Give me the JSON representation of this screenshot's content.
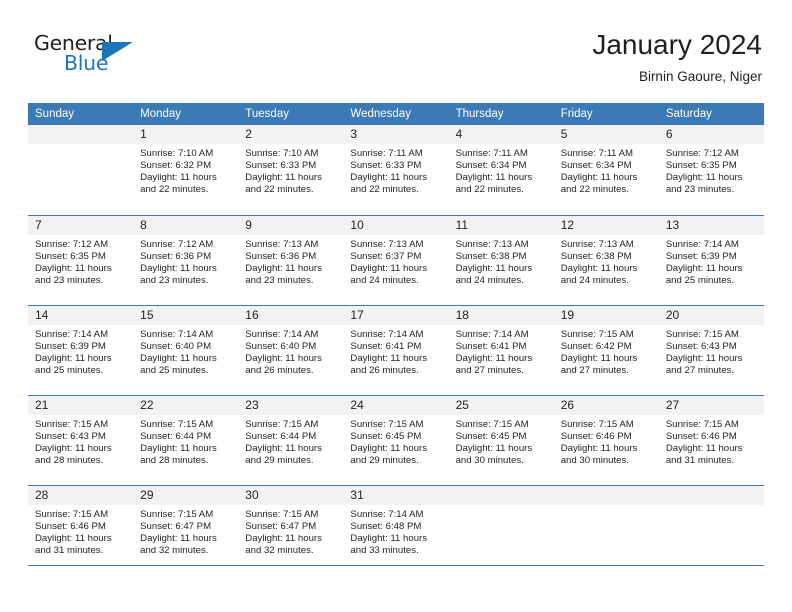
{
  "brand": {
    "name_top": "General",
    "name_bottom": "Blue",
    "accent_color": "#1b75bb"
  },
  "header": {
    "title": "January 2024",
    "subtitle": "Birnin Gaoure, Niger"
  },
  "theme": {
    "header_bg": "#3b7ab5",
    "daynum_bg": "#f2f2f2",
    "text": "#231f20"
  },
  "weekdays": [
    "Sunday",
    "Monday",
    "Tuesday",
    "Wednesday",
    "Thursday",
    "Friday",
    "Saturday"
  ],
  "weeks": [
    [
      {
        "day": "",
        "sunrise": "",
        "sunset": "",
        "daylight": "",
        "empty": true
      },
      {
        "day": "1",
        "sunrise": "Sunrise: 7:10 AM",
        "sunset": "Sunset: 6:32 PM",
        "daylight": "Daylight: 11 hours and 22 minutes."
      },
      {
        "day": "2",
        "sunrise": "Sunrise: 7:10 AM",
        "sunset": "Sunset: 6:33 PM",
        "daylight": "Daylight: 11 hours and 22 minutes."
      },
      {
        "day": "3",
        "sunrise": "Sunrise: 7:11 AM",
        "sunset": "Sunset: 6:33 PM",
        "daylight": "Daylight: 11 hours and 22 minutes."
      },
      {
        "day": "4",
        "sunrise": "Sunrise: 7:11 AM",
        "sunset": "Sunset: 6:34 PM",
        "daylight": "Daylight: 11 hours and 22 minutes."
      },
      {
        "day": "5",
        "sunrise": "Sunrise: 7:11 AM",
        "sunset": "Sunset: 6:34 PM",
        "daylight": "Daylight: 11 hours and 22 minutes."
      },
      {
        "day": "6",
        "sunrise": "Sunrise: 7:12 AM",
        "sunset": "Sunset: 6:35 PM",
        "daylight": "Daylight: 11 hours and 23 minutes."
      }
    ],
    [
      {
        "day": "7",
        "sunrise": "Sunrise: 7:12 AM",
        "sunset": "Sunset: 6:35 PM",
        "daylight": "Daylight: 11 hours and 23 minutes."
      },
      {
        "day": "8",
        "sunrise": "Sunrise: 7:12 AM",
        "sunset": "Sunset: 6:36 PM",
        "daylight": "Daylight: 11 hours and 23 minutes."
      },
      {
        "day": "9",
        "sunrise": "Sunrise: 7:13 AM",
        "sunset": "Sunset: 6:36 PM",
        "daylight": "Daylight: 11 hours and 23 minutes."
      },
      {
        "day": "10",
        "sunrise": "Sunrise: 7:13 AM",
        "sunset": "Sunset: 6:37 PM",
        "daylight": "Daylight: 11 hours and 24 minutes."
      },
      {
        "day": "11",
        "sunrise": "Sunrise: 7:13 AM",
        "sunset": "Sunset: 6:38 PM",
        "daylight": "Daylight: 11 hours and 24 minutes."
      },
      {
        "day": "12",
        "sunrise": "Sunrise: 7:13 AM",
        "sunset": "Sunset: 6:38 PM",
        "daylight": "Daylight: 11 hours and 24 minutes."
      },
      {
        "day": "13",
        "sunrise": "Sunrise: 7:14 AM",
        "sunset": "Sunset: 6:39 PM",
        "daylight": "Daylight: 11 hours and 25 minutes."
      }
    ],
    [
      {
        "day": "14",
        "sunrise": "Sunrise: 7:14 AM",
        "sunset": "Sunset: 6:39 PM",
        "daylight": "Daylight: 11 hours and 25 minutes."
      },
      {
        "day": "15",
        "sunrise": "Sunrise: 7:14 AM",
        "sunset": "Sunset: 6:40 PM",
        "daylight": "Daylight: 11 hours and 25 minutes."
      },
      {
        "day": "16",
        "sunrise": "Sunrise: 7:14 AM",
        "sunset": "Sunset: 6:40 PM",
        "daylight": "Daylight: 11 hours and 26 minutes."
      },
      {
        "day": "17",
        "sunrise": "Sunrise: 7:14 AM",
        "sunset": "Sunset: 6:41 PM",
        "daylight": "Daylight: 11 hours and 26 minutes."
      },
      {
        "day": "18",
        "sunrise": "Sunrise: 7:14 AM",
        "sunset": "Sunset: 6:41 PM",
        "daylight": "Daylight: 11 hours and 27 minutes."
      },
      {
        "day": "19",
        "sunrise": "Sunrise: 7:15 AM",
        "sunset": "Sunset: 6:42 PM",
        "daylight": "Daylight: 11 hours and 27 minutes."
      },
      {
        "day": "20",
        "sunrise": "Sunrise: 7:15 AM",
        "sunset": "Sunset: 6:43 PM",
        "daylight": "Daylight: 11 hours and 27 minutes."
      }
    ],
    [
      {
        "day": "21",
        "sunrise": "Sunrise: 7:15 AM",
        "sunset": "Sunset: 6:43 PM",
        "daylight": "Daylight: 11 hours and 28 minutes."
      },
      {
        "day": "22",
        "sunrise": "Sunrise: 7:15 AM",
        "sunset": "Sunset: 6:44 PM",
        "daylight": "Daylight: 11 hours and 28 minutes."
      },
      {
        "day": "23",
        "sunrise": "Sunrise: 7:15 AM",
        "sunset": "Sunset: 6:44 PM",
        "daylight": "Daylight: 11 hours and 29 minutes."
      },
      {
        "day": "24",
        "sunrise": "Sunrise: 7:15 AM",
        "sunset": "Sunset: 6:45 PM",
        "daylight": "Daylight: 11 hours and 29 minutes."
      },
      {
        "day": "25",
        "sunrise": "Sunrise: 7:15 AM",
        "sunset": "Sunset: 6:45 PM",
        "daylight": "Daylight: 11 hours and 30 minutes."
      },
      {
        "day": "26",
        "sunrise": "Sunrise: 7:15 AM",
        "sunset": "Sunset: 6:46 PM",
        "daylight": "Daylight: 11 hours and 30 minutes."
      },
      {
        "day": "27",
        "sunrise": "Sunrise: 7:15 AM",
        "sunset": "Sunset: 6:46 PM",
        "daylight": "Daylight: 11 hours and 31 minutes."
      }
    ],
    [
      {
        "day": "28",
        "sunrise": "Sunrise: 7:15 AM",
        "sunset": "Sunset: 6:46 PM",
        "daylight": "Daylight: 11 hours and 31 minutes."
      },
      {
        "day": "29",
        "sunrise": "Sunrise: 7:15 AM",
        "sunset": "Sunset: 6:47 PM",
        "daylight": "Daylight: 11 hours and 32 minutes."
      },
      {
        "day": "30",
        "sunrise": "Sunrise: 7:15 AM",
        "sunset": "Sunset: 6:47 PM",
        "daylight": "Daylight: 11 hours and 32 minutes."
      },
      {
        "day": "31",
        "sunrise": "Sunrise: 7:14 AM",
        "sunset": "Sunset: 6:48 PM",
        "daylight": "Daylight: 11 hours and 33 minutes."
      },
      {
        "day": "",
        "sunrise": "",
        "sunset": "",
        "daylight": "",
        "empty": true
      },
      {
        "day": "",
        "sunrise": "",
        "sunset": "",
        "daylight": "",
        "empty": true
      },
      {
        "day": "",
        "sunrise": "",
        "sunset": "",
        "daylight": "",
        "empty": true
      }
    ]
  ]
}
